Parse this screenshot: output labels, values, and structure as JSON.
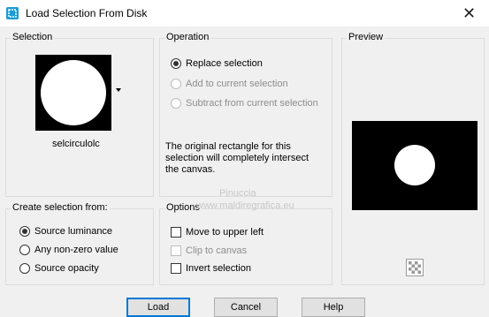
{
  "window": {
    "title": "Load Selection From Disk",
    "close_glyph": "✕"
  },
  "selection": {
    "group_label": "Selection",
    "file_name": "selcirculolc"
  },
  "operation": {
    "group_label": "Operation",
    "options": [
      "Replace selection",
      "Add to current selection",
      "Subtract from current selection"
    ],
    "message": [
      "The original rectangle for this",
      "selection will completely intersect",
      "the canvas."
    ]
  },
  "preview": {
    "group_label": "Preview"
  },
  "create_from": {
    "group_label": "Create selection from:",
    "options": [
      "Source luminance",
      "Any non-zero value",
      "Source opacity"
    ]
  },
  "options_group": {
    "group_label": "Options",
    "items": [
      "Move to upper left",
      "Clip to canvas",
      "Invert selection"
    ]
  },
  "buttons": {
    "load": "Load",
    "cancel": "Cancel",
    "help": "Help"
  },
  "watermark": {
    "line1": "Pinuccia",
    "line2": "www.maldiregrafica.eu"
  },
  "colors": {
    "accent": "#0078d7",
    "app_icon": "#1b9bd8"
  }
}
